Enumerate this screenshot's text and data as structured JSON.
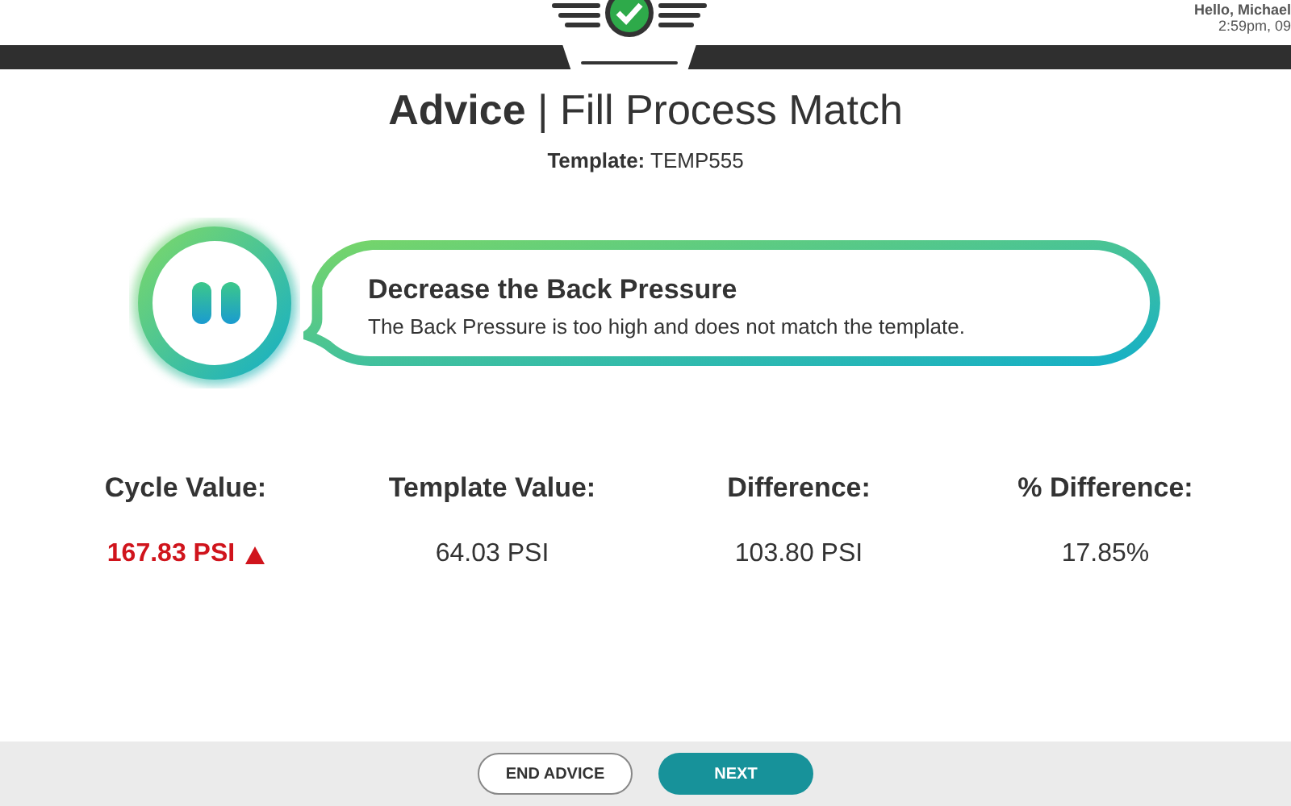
{
  "header": {
    "greeting": "Hello, Michael",
    "time": "2:59pm, 09"
  },
  "title": "**Advice** | Fill Process Match",
  "template": "**Template:** TEMP555",
  "advice": {
    "title": "Decrease the Back Pressure",
    "message": "The Back Pressure is too high and does not match the template."
  },
  "metrics": [
    {
      "label": "Cycle Value:",
      "value": "167.83 PSI",
      "above_template": true
    },
    {
      "label": "Template Value:",
      "value": "64.03 PSI"
    },
    {
      "label": "Difference:",
      "value": "103.80 PSI"
    },
    {
      "label": "% Difference:",
      "value": "17.85%"
    }
  ],
  "buttons": [
    {
      "label": "END ADVICE",
      "kind": "outline"
    },
    {
      "label": "NEXT",
      "kind": "primary"
    }
  ]
}
